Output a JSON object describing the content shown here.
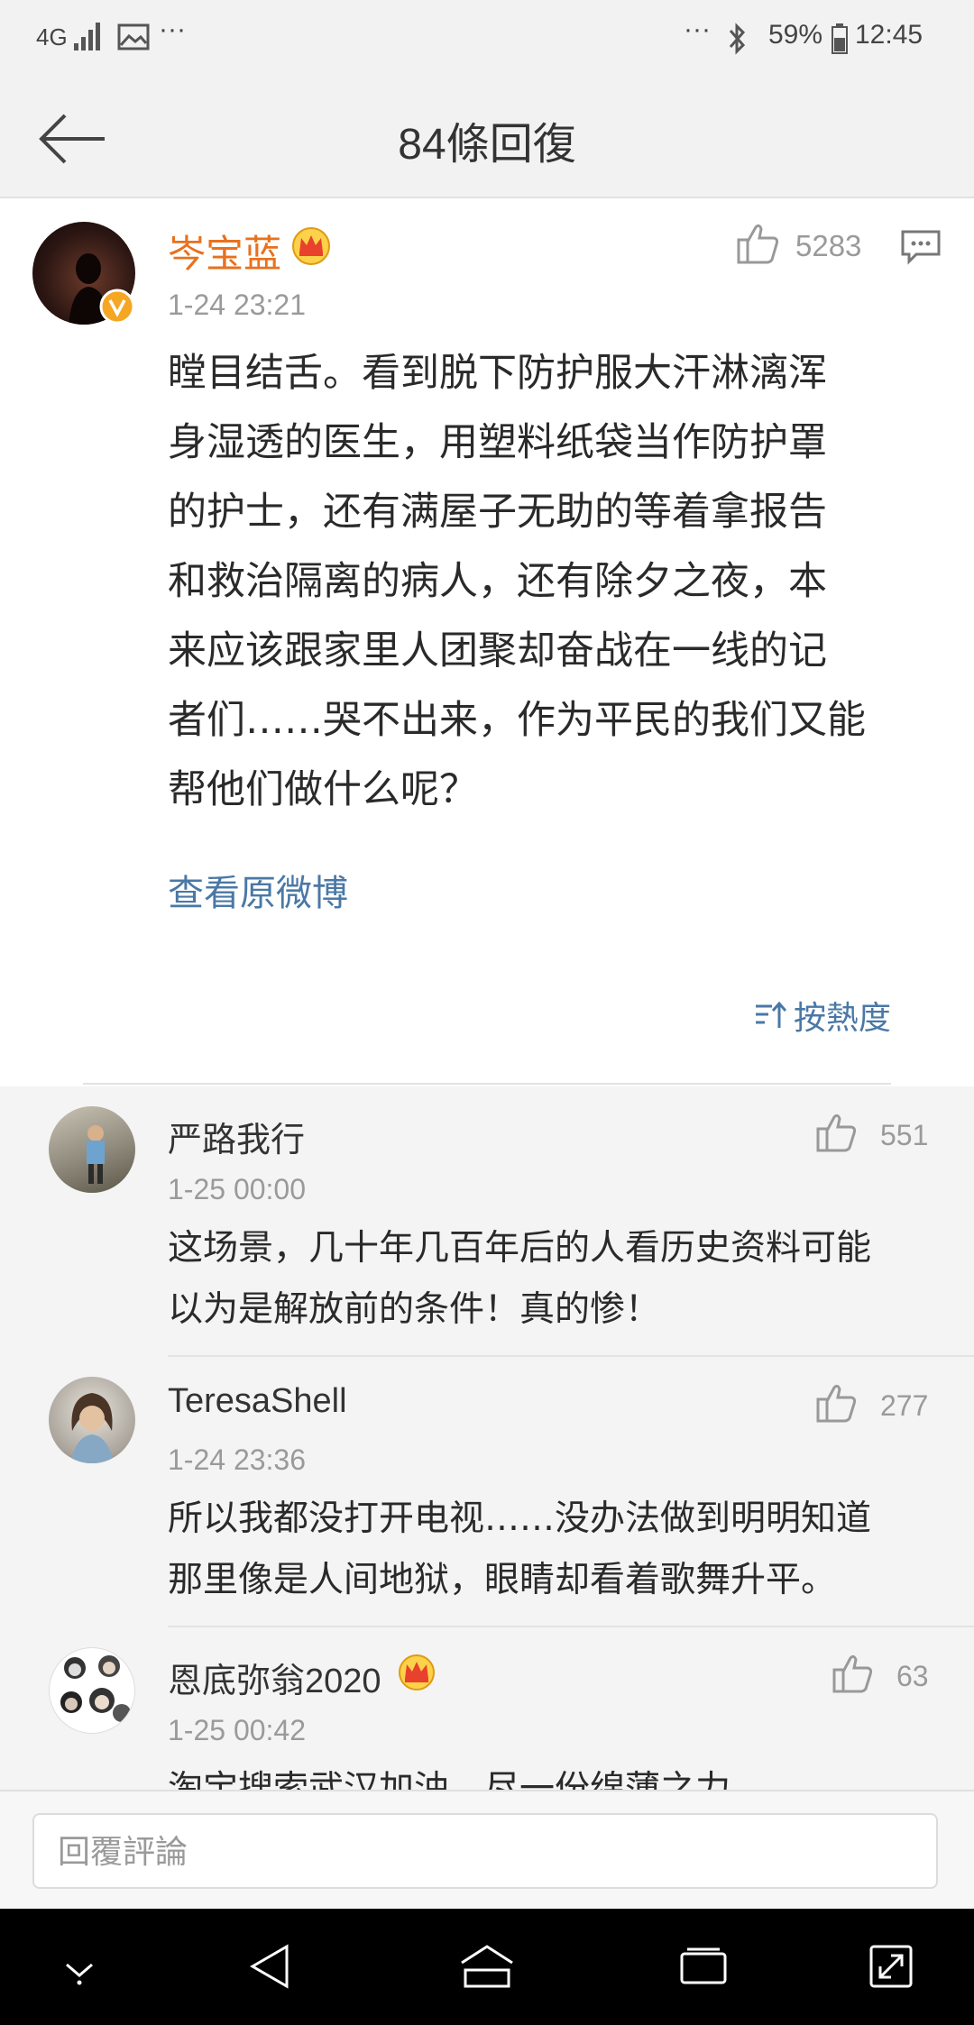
{
  "status_bar": {
    "network": "4G",
    "more": "···",
    "more_right": "···",
    "battery": "59%",
    "time": "12:45"
  },
  "header": {
    "title": "84條回復"
  },
  "post": {
    "author": "岑宝蓝",
    "time": "1-24 23:21",
    "likes": "5283",
    "body_lines": [
      "瞠目结舌。看到脱下防护服大汗淋漓浑",
      "身湿透的医生，用塑料纸袋当作防护罩",
      "的护士，还有满屋子无助的等着拿报告",
      "和救治隔离的病人，还有除夕之夜，本",
      "来应该跟家里人团聚却奋战在一线的记",
      "者们……哭不出来，作为平民的我们又能",
      "帮他们做什么呢？"
    ],
    "view_original": "查看原微博",
    "sort_label": "按熱度"
  },
  "comments": [
    {
      "name": "严路我行",
      "time": "1-25 00:00",
      "likes": "551",
      "lines": [
        "这场景，几十年几百年后的人看历史资料可能",
        "以为是解放前的条件！真的惨！"
      ]
    },
    {
      "name": "TeresaShell",
      "time": "1-24 23:36",
      "likes": "277",
      "lines": [
        "所以我都没打开电视……没办法做到明明知道",
        "那里像是人间地狱，眼睛却看着歌舞升平。"
      ]
    },
    {
      "name": "恩底弥翁2020",
      "time": "1-25 00:42",
      "likes": "63",
      "lines": [
        "淘宝搜索武汉加油，尽一份绵薄之力"
      ]
    }
  ],
  "reply": {
    "placeholder": "回覆評論"
  },
  "colors": {
    "accent_orange": "#e8711d",
    "link_blue": "#4a78a6",
    "verified_gold": "#f5a623"
  },
  "icons": [
    "back-arrow-icon",
    "like-icon",
    "comment-icon",
    "sort-icon",
    "crown-badge-icon",
    "verified-v-icon",
    "bluetooth-icon",
    "battery-icon",
    "signal-icon",
    "image-icon"
  ]
}
